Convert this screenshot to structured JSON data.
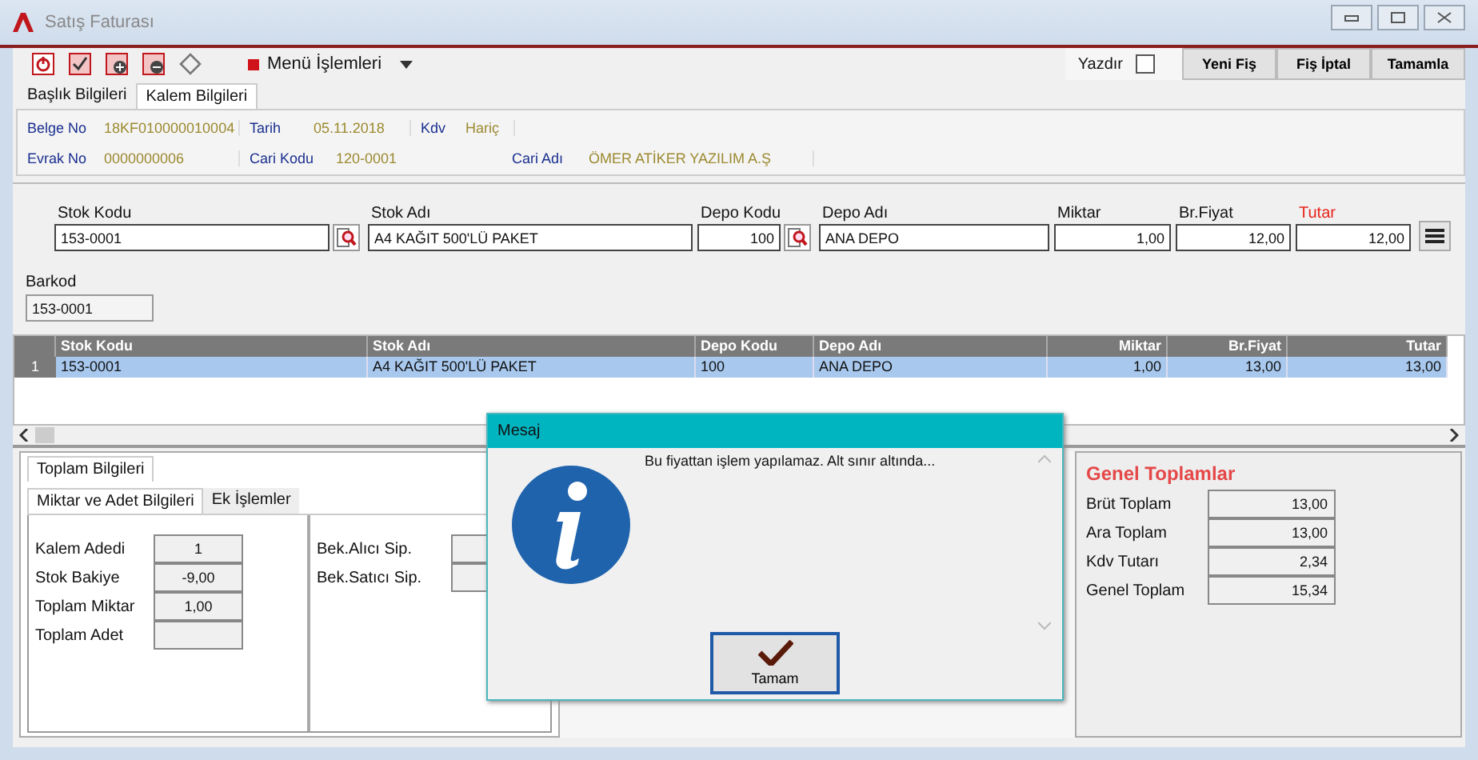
{
  "window": {
    "title": "Satış Faturası"
  },
  "toolbar": {
    "menu_label": "Menü İşlemleri",
    "print": {
      "label": "Yazdır",
      "checked": false
    },
    "buttons": [
      "Yeni Fiş",
      "Fiş İptal",
      "Tamamla"
    ]
  },
  "tabs": [
    {
      "label": "Başlık Bilgileri",
      "selected": false
    },
    {
      "label": "Kalem Bilgileri",
      "selected": true
    }
  ],
  "header": {
    "rows": [
      [
        {
          "label": "Belge No",
          "value": "18KF010000010004"
        },
        {
          "label": "Tarih",
          "value": "05.11.2018"
        },
        {
          "label": "Kdv",
          "value": "Hariç"
        }
      ],
      [
        {
          "label": "Evrak No",
          "value": "0000000006"
        },
        {
          "label": "Cari Kodu",
          "value": "120-0001"
        },
        {
          "label": "Cari Adı",
          "value": "ÖMER ATİKER YAZILIM A.Ş"
        }
      ]
    ]
  },
  "entry": {
    "fields": [
      {
        "label": "Stok Kodu",
        "value": "153-0001",
        "lookup": true,
        "numeric": false,
        "emphasized": false
      },
      {
        "label": "Stok Adı",
        "value": "A4 KAĞIT 500'LÜ PAKET",
        "lookup": false,
        "numeric": false,
        "emphasized": false
      },
      {
        "label": "Depo Kodu",
        "value": "100",
        "lookup": true,
        "numeric": true,
        "emphasized": false
      },
      {
        "label": "Depo Adı",
        "value": "ANA DEPO",
        "lookup": false,
        "numeric": false,
        "emphasized": false
      },
      {
        "label": "Miktar",
        "value": "1,00",
        "lookup": false,
        "numeric": true,
        "emphasized": false
      },
      {
        "label": "Br.Fiyat",
        "value": "12,00",
        "lookup": false,
        "numeric": true,
        "emphasized": false
      },
      {
        "label": "Tutar",
        "value": "12,00",
        "lookup": false,
        "numeric": true,
        "emphasized": true
      }
    ],
    "barcode": {
      "label": "Barkod",
      "value": "153-0001"
    }
  },
  "grid": {
    "columns": [
      {
        "label": "Stok Kodu",
        "numeric": false
      },
      {
        "label": "Stok Adı",
        "numeric": false
      },
      {
        "label": "Depo Kodu",
        "numeric": false
      },
      {
        "label": "Depo Adı",
        "numeric": false
      },
      {
        "label": "Miktar",
        "numeric": true
      },
      {
        "label": "Br.Fiyat",
        "numeric": true
      },
      {
        "label": "Tutar",
        "numeric": true
      }
    ],
    "rows": [
      {
        "number": "1",
        "selected": true,
        "cells": [
          "153-0001",
          "A4 KAĞIT 500'LÜ PAKET",
          "100",
          "ANA DEPO",
          "1,00",
          "13,00",
          "13,00"
        ]
      }
    ]
  },
  "totals": {
    "tab": "Toplam Bilgileri",
    "subtabs": [
      {
        "label": "Miktar ve Adet Bilgileri",
        "selected": true
      },
      {
        "label": "Ek İşlemler",
        "selected": false
      }
    ],
    "quantity_fields": [
      {
        "label": "Kalem Adedi",
        "value": "1"
      },
      {
        "label": "Stok Bakiye",
        "value": "-9,00"
      },
      {
        "label": "Toplam Miktar",
        "value": "1,00"
      },
      {
        "label": "Toplam Adet"
      }
    ],
    "order_fields": [
      {
        "label": "Bek.Alıcı Sip."
      },
      {
        "label": "Bek.Satıcı Sip."
      }
    ]
  },
  "grand_totals": {
    "title": "Genel Toplamlar",
    "fields": [
      {
        "label": "Brüt Toplam",
        "value": "13,00"
      },
      {
        "label": "Ara Toplam",
        "value": "13,00"
      },
      {
        "label": "Kdv Tutarı",
        "value": "2,34"
      },
      {
        "label": "Genel Toplam",
        "value": "15,34"
      }
    ]
  },
  "dialog": {
    "title": "Mesaj",
    "message": "Bu fiyattan işlem yapılamaz. Alt sınır altında...",
    "button": "Tamam"
  }
}
